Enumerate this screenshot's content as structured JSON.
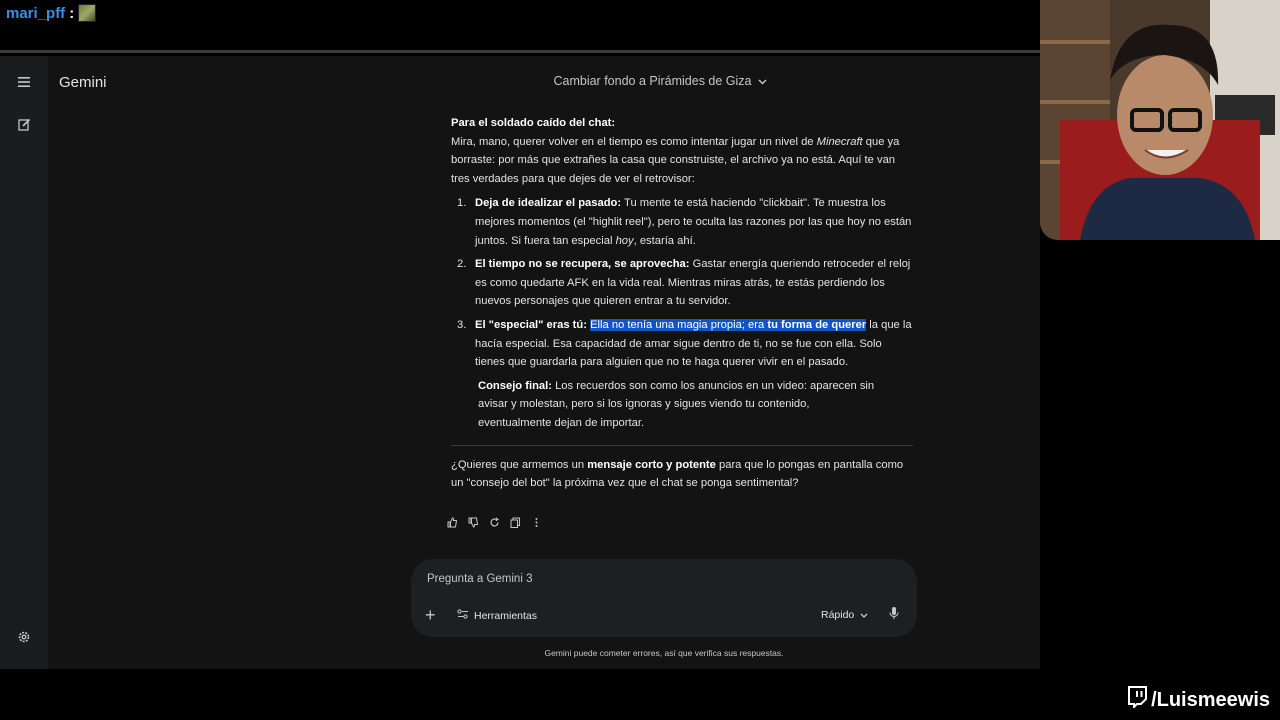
{
  "stream_chat": {
    "username": "mari_pff",
    "separator": ":"
  },
  "app": {
    "name": "Gemini"
  },
  "conversation": {
    "title": "Cambiar fondo a Pirámides de Giza"
  },
  "response": {
    "heading": "Para el soldado caído del chat:",
    "intro_before": "Mira, mano, querer volver en el tiempo es como intentar jugar un nivel de ",
    "intro_em": "Minecraft",
    "intro_after": " que ya borraste: por más que extrañes la casa que construiste, el archivo ya no está. Aquí te van tres verdades para que dejes de ver el retrovisor:",
    "items": [
      {
        "num": "1.",
        "title": "Deja de idealizar el pasado:",
        "text_before": " Tu mente te está haciendo \"clickbait\". Te muestra los mejores momentos (el \"highlit reel\"), pero te oculta las razones por las que hoy no están juntos. Si fuera tan especial ",
        "text_em": "hoy",
        "text_after": ", estaría ahí."
      },
      {
        "num": "2.",
        "title": "El tiempo no se recupera, se aprovecha:",
        "text": " Gastar energía queriendo retroceder el reloj es como quedarte AFK en la vida real. Mientras miras atrás, te estás perdiendo los nuevos personajes que quieren entrar a tu servidor."
      },
      {
        "num": "3.",
        "title": "El \"especial\" eras tú:",
        "highlight_plain": "Ella no tenía una magia propia; era ",
        "highlight_bold": "tu forma de querer",
        "text": " la que la hacía especial. Esa capacidad de amar sigue dentro de ti, no se fue con ella. Solo tienes que guardarla para alguien que no te haga querer vivir en el pasado."
      }
    ],
    "tip_title": "Consejo final:",
    "tip_text": " Los recuerdos son como los anuncios en un video: aparecen sin avisar y molestan, pero si los ignoras y sigues viendo tu contenido, eventualmente dejan de importar.",
    "followup_before": "¿Quieres que armemos un ",
    "followup_bold": "mensaje corto y potente",
    "followup_after": " para que lo pongas en pantalla como un \"consejo del bot\" la próxima vez que el chat se ponga sentimental?"
  },
  "composer": {
    "placeholder": "Pregunta a Gemini 3",
    "tools_label": "Herramientas",
    "mode_label": "Rápido"
  },
  "disclaimer": "Gemini puede cometer errores, así que verifica sus respuestas.",
  "overlay": {
    "channel": "/Luismeewis"
  },
  "icons": [
    "menu-icon",
    "new-chat-icon",
    "settings-icon",
    "thumbs-up-icon",
    "thumbs-down-icon",
    "refresh-icon",
    "copy-icon",
    "more-icon",
    "plus-icon",
    "tools-icon",
    "chevron-down-icon",
    "mic-icon",
    "twitch-icon"
  ],
  "colors": {
    "background": "#131314",
    "rail": "#1b1c1d",
    "composer": "#1e1f20",
    "selection": "#1452c7",
    "chat_username": "#3b8ee8"
  }
}
